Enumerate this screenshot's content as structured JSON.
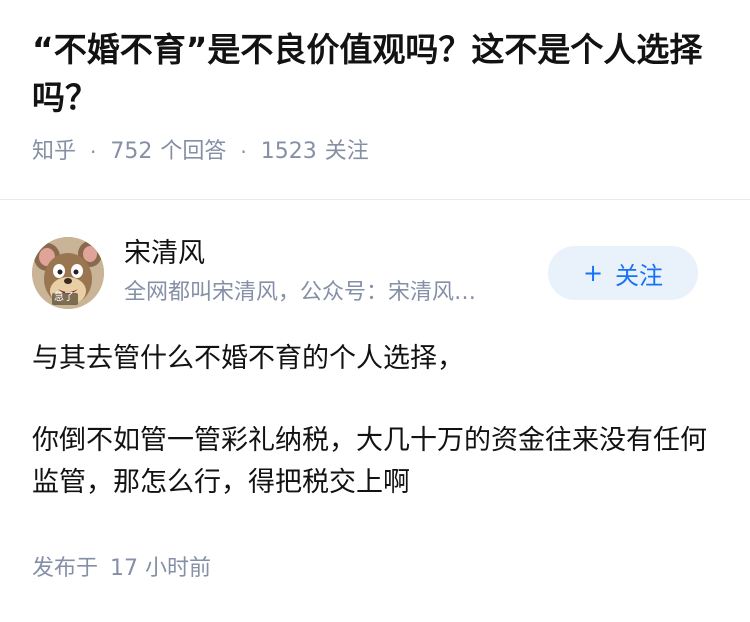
{
  "question": {
    "title": "“不婚不育”是不良价值观吗？这不是个人选择吗？",
    "source": "知乎",
    "answer_count": "752",
    "answer_count_label": "个回答",
    "follower_count": "1523",
    "follower_label": "关注"
  },
  "author": {
    "name": "宋清风",
    "bio": "全网都叫宋清风，公众号：宋清风…",
    "avatar_icon": "cartoon-mouse-avatar",
    "avatar_caption": "急了",
    "follow_label": "关注",
    "follow_icon": "plus-icon"
  },
  "answer": {
    "paragraphs": [
      "与其去管什么不婚不育的个人选择，",
      "你倒不如管一管彩礼纳税，大几十万的资金往来没有任何监管，那怎么行，得把税交上啊"
    ],
    "time_label": "发布于",
    "time_value": "17 小时前"
  },
  "colors": {
    "accent": "#1772f6",
    "follow_bg": "#e9f1fb",
    "meta_gray": "#8590a6",
    "text": "#121212"
  }
}
